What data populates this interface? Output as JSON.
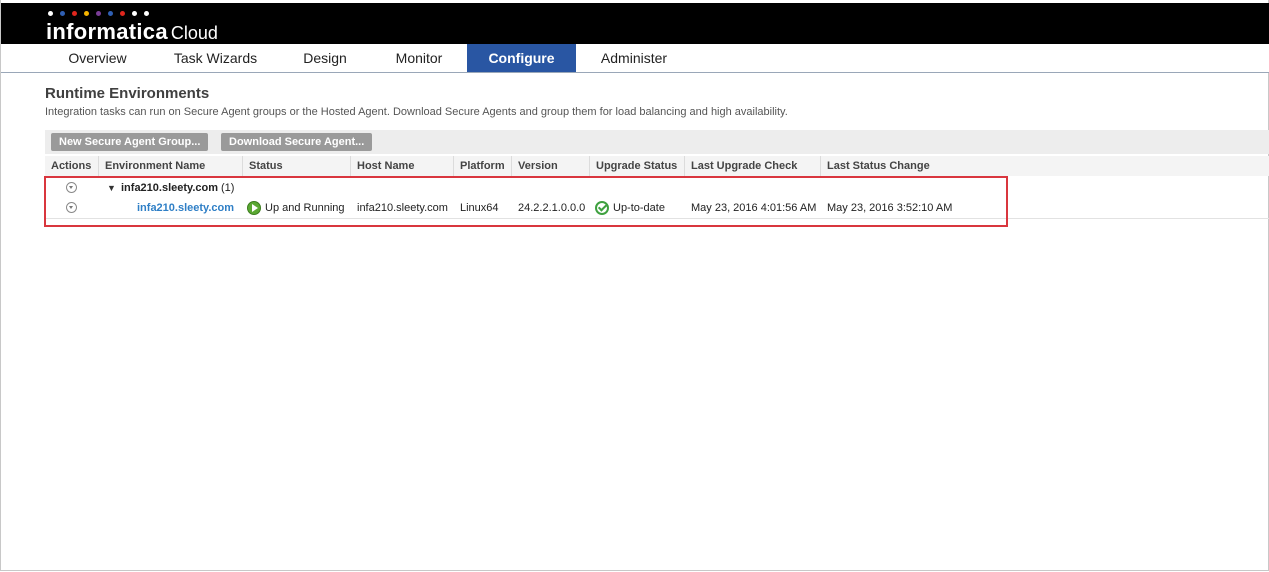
{
  "app": {
    "logo_word": "informatica",
    "logo_suffix": "Cloud",
    "logo_dot_colors": [
      "#ffffff",
      "#2f5fb3",
      "#e0261d",
      "#f5b400",
      "#7a3d97",
      "#2f5fb3",
      "#e0261d",
      "#ffffff"
    ]
  },
  "nav": {
    "tabs": [
      {
        "label": "Overview"
      },
      {
        "label": "Task Wizards"
      },
      {
        "label": "Design"
      },
      {
        "label": "Monitor"
      },
      {
        "label": "Configure",
        "active": true
      },
      {
        "label": "Administer"
      }
    ],
    "active_color": "#2956a3"
  },
  "page": {
    "title": "Runtime Environments",
    "description": "Integration tasks can run on Secure Agent groups or the Hosted Agent. Download Secure Agents and group them for load balancing and high availability."
  },
  "toolbar": {
    "new_group_label": "New Secure Agent Group...",
    "download_label": "Download Secure Agent..."
  },
  "table": {
    "columns": [
      "Actions",
      "Environment Name",
      "Status",
      "Host Name",
      "Platform",
      "Version",
      "Upgrade Status",
      "Last Upgrade Check",
      "Last Status Change"
    ],
    "group": {
      "name": "infa210.sleety.com",
      "count": "(1)",
      "expand_icon": "triangle-down-icon",
      "action_icon": "menu-dropdown-icon"
    },
    "agent": {
      "name": "infa210.sleety.com",
      "status": "Up and Running",
      "status_icon": "running-icon",
      "host_name": "infa210.sleety.com",
      "platform": "Linux64",
      "version": "24.2.2.1.0.0.0",
      "upgrade_status": "Up-to-date",
      "upgrade_icon": "check-circle-icon",
      "last_upgrade_check": "May 23, 2016 4:01:56 AM",
      "last_status_change": "May 23, 2016 3:52:10 AM"
    }
  },
  "highlight_color": "#d9363e"
}
